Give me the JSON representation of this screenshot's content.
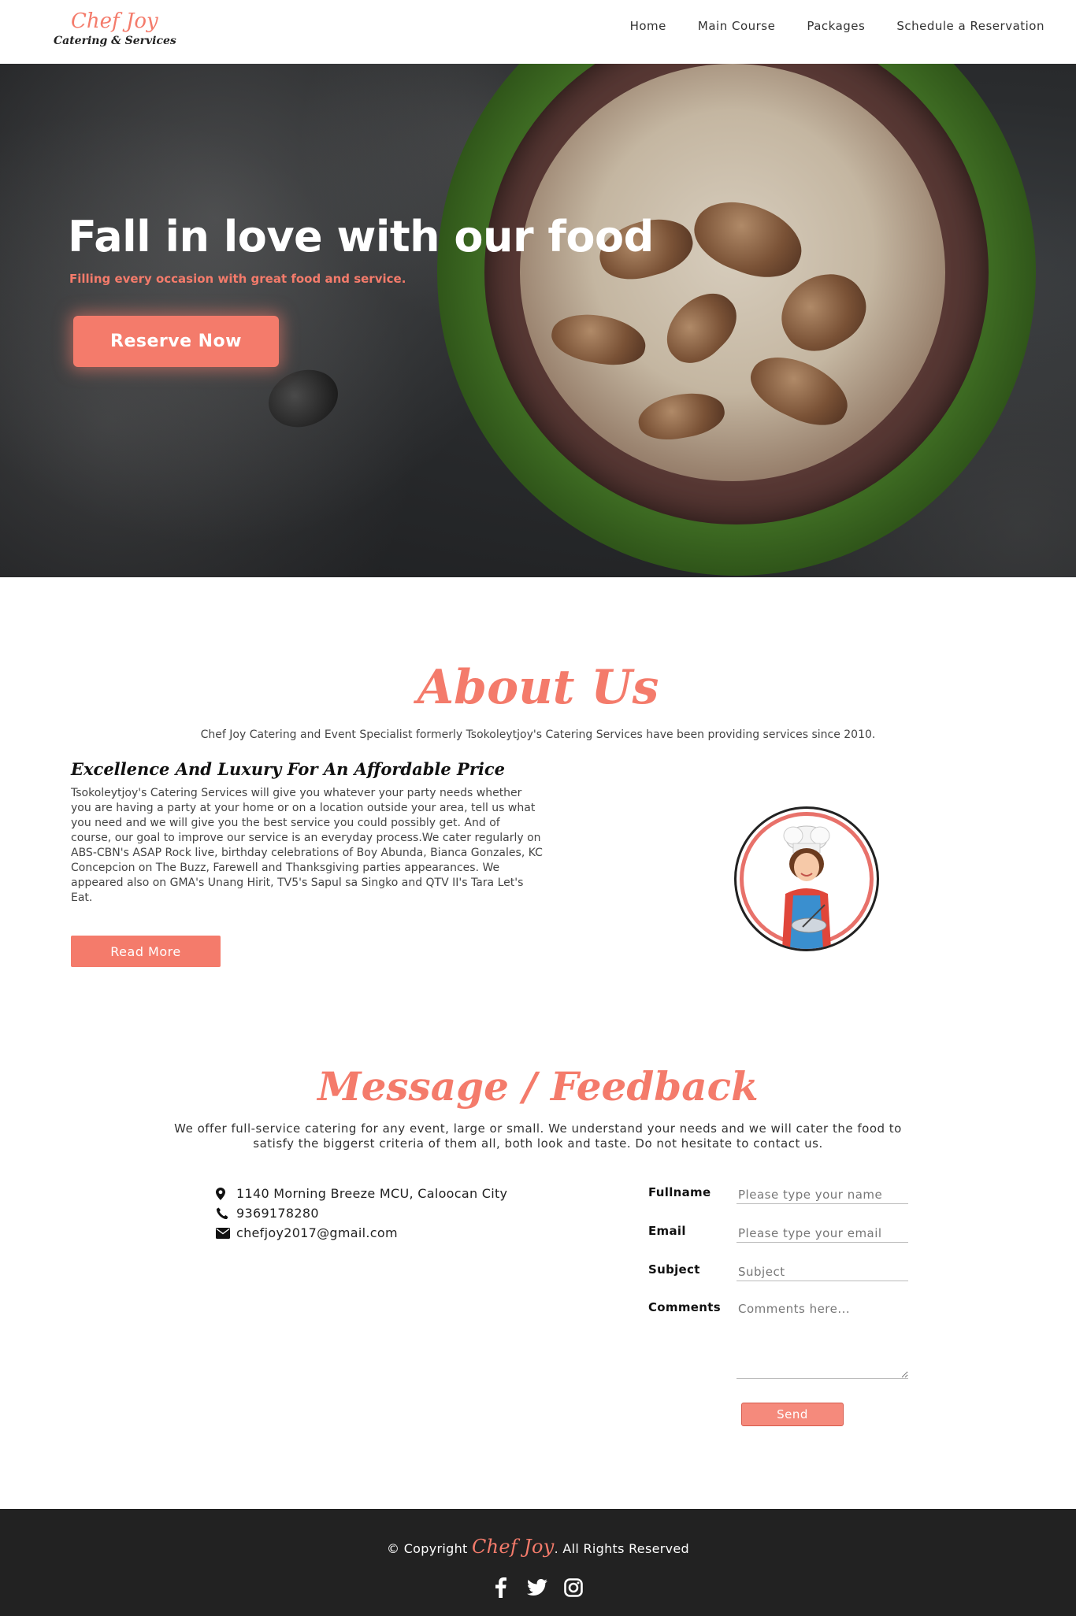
{
  "nav": {
    "logo_line1": "Chef Joy",
    "logo_line2": "Catering & Services",
    "links": [
      "Home",
      "Main Course",
      "Packages",
      "Schedule a Reservation"
    ]
  },
  "hero": {
    "title": "Fall in love with our food",
    "subtitle": "Filling every occasion with great food and service.",
    "button": "Reserve Now"
  },
  "about": {
    "title": "About Us",
    "intro": "Chef Joy Catering and Event Specialist formerly Tsokoleytjoy's Catering Services have been providing services since 2010.",
    "heading": "Excellence And Luxury For An Affordable Price",
    "text": "Tsokoleytjoy's Catering Services will give you whatever your party needs whether you are having a party at your home or on a location outside your area, tell us what you need and we will give you the best service you could possibly get. And of course, our goal to improve our service is an everyday process.We cater regularly on ABS-CBN's ASAP Rock live, birthday celebrations of Boy Abunda, Bianca Gonzales, KC Concepcion on The Buzz, Farewell and Thanksgiving parties appearances. We appeared also on GMA's Unang Hirit, TV5's Sapul sa Singko and QTV II's Tara Let's Eat.",
    "button": "Read More"
  },
  "message": {
    "title": "Message / Feedback",
    "intro": "We offer full-service catering for any event, large or small. We understand your needs and we will cater the food to satisfy the biggerst criteria of them all, both look and taste. Do not hesitate to contact us.",
    "address": "1140 Morning Breeze MCU, Caloocan City",
    "phone": "9369178280",
    "email": "chefjoy2017@gmail.com",
    "form": {
      "fullname_label": "Fullname",
      "fullname_placeholder": "Please type your name",
      "email_label": "Email",
      "email_placeholder": "Please type your email",
      "subject_label": "Subject",
      "subject_placeholder": "Subject",
      "comments_label": "Comments",
      "comments_placeholder": "Comments here...",
      "send": "Send"
    }
  },
  "footer": {
    "copyright_prefix": "© Copyright",
    "brand": "Chef Joy",
    "copyright_suffix": ". All Rights Reserved",
    "social_icons": [
      "facebook-icon",
      "twitter-icon",
      "instagram-icon"
    ]
  },
  "colors": {
    "accent": "#f47b6b",
    "footer_bg": "#222222"
  }
}
